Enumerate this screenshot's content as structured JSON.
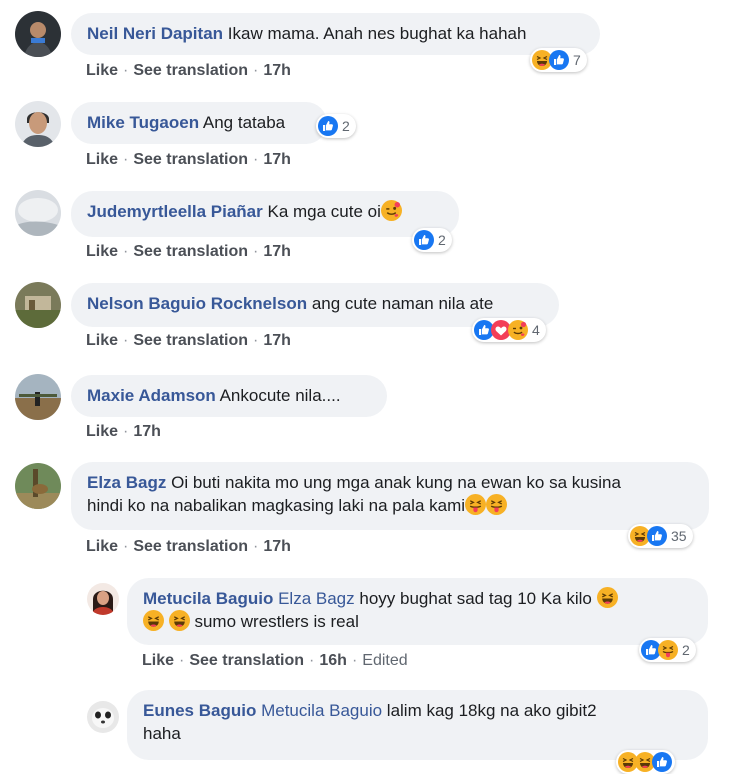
{
  "comments": [
    {
      "author": "Neil Neri Dapitan",
      "text": "Ikaw mama. Anah nes bughat ka hahah",
      "like": "Like",
      "translate": "See translation",
      "time": "17h",
      "reaction_count": "7"
    },
    {
      "author": "Mike Tugaoen",
      "text": "Ang tataba",
      "like": "Like",
      "translate": "See translation",
      "time": "17h",
      "reaction_count": "2"
    },
    {
      "author": "Judemyrtleella Piañar",
      "text": "Ka mga cute oi",
      "like": "Like",
      "translate": "See translation",
      "time": "17h",
      "reaction_count": "2"
    },
    {
      "author": "Nelson Baguio Rocknelson",
      "text": "ang cute naman nila ate",
      "like": "Like",
      "translate": "See translation",
      "time": "17h",
      "reaction_count": "4"
    },
    {
      "author": "Maxie Adamson",
      "text": "Ankocute nila....",
      "like": "Like",
      "time": "17h"
    },
    {
      "author": "Elza Bagz",
      "text_line1": "Oi buti nakita mo ung mga anak kung na ewan ko sa kusina",
      "text_line2": "hindi ko na nabalikan magkasing laki na pala kami",
      "like": "Like",
      "translate": "See translation",
      "time": "17h",
      "reaction_count": "35"
    }
  ],
  "replies": [
    {
      "author": "Metucila Baguio",
      "mention": "Elza Bagz",
      "text_line1": "hoyy bughat sad tag 10 Ka kilo",
      "text_line2": "sumo wrestlers is real",
      "like": "Like",
      "translate": "See translation",
      "time": "16h",
      "edited": "Edited",
      "reaction_count": "2"
    },
    {
      "author": "Eunes Baguio",
      "mention": "Metucila Baguio",
      "text_line1": "lalim kag 18kg na ako gibit2",
      "text_line2": "haha"
    }
  ],
  "separator": "·",
  "colors": {
    "author": "#385898",
    "bubble": "#f0f2f5",
    "like_blue": "#1877f2",
    "haha_yellow": "#f7b125",
    "love_red": "#f33e58"
  }
}
